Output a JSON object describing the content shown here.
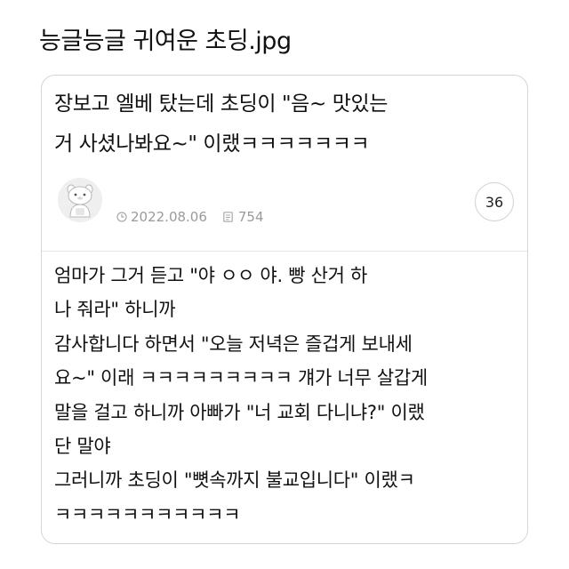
{
  "page": {
    "title": "능글능글 귀여운 초딩.jpg"
  },
  "post": {
    "title": "장보고 엘베 탔는데 초딩이 \"음~ 맛있는 거 사셨나봐요~\" 이랬ㅋㅋㅋㅋㅋㅋㅋ",
    "title_lines": [
      "장보고 엘베 탔는데 초딩이 \"음~ 맛있는",
      "거 사셨나봐요~\" 이랬ㅋㅋㅋㅋㅋㅋㅋ"
    ],
    "date": "2022.08.06",
    "views": "754",
    "comment_count": "36",
    "body_lines": [
      "엄마가 그거 듣고 \"야 ㅇㅇ 야. 빵 산거 하",
      "나 줘라\" 하니까",
      "감사합니다 하면서 \"오늘 저녁은 즐겁게 보내세",
      "요~\" 이래 ㅋㅋㅋㅋㅋㅋㅋㅋㅋ 걔가 너무 살갑게",
      "말을 걸고 하니까 아빠가 \"너 교회 다니냐?\" 이랬",
      "단 말야",
      "그러니까 초딩이 \"뼛속까지 불교입니다\" 이랬ㅋ",
      "ㅋㅋㅋㅋㅋㅋㅋㅋㅋㅋㅋ"
    ]
  },
  "icons": {
    "avatar": "avatar-character-icon",
    "date": "clock-icon",
    "views": "views-icon"
  },
  "colors": {
    "text": "#111111",
    "meta": "#9a9a9a",
    "border": "#d6d6d6"
  }
}
